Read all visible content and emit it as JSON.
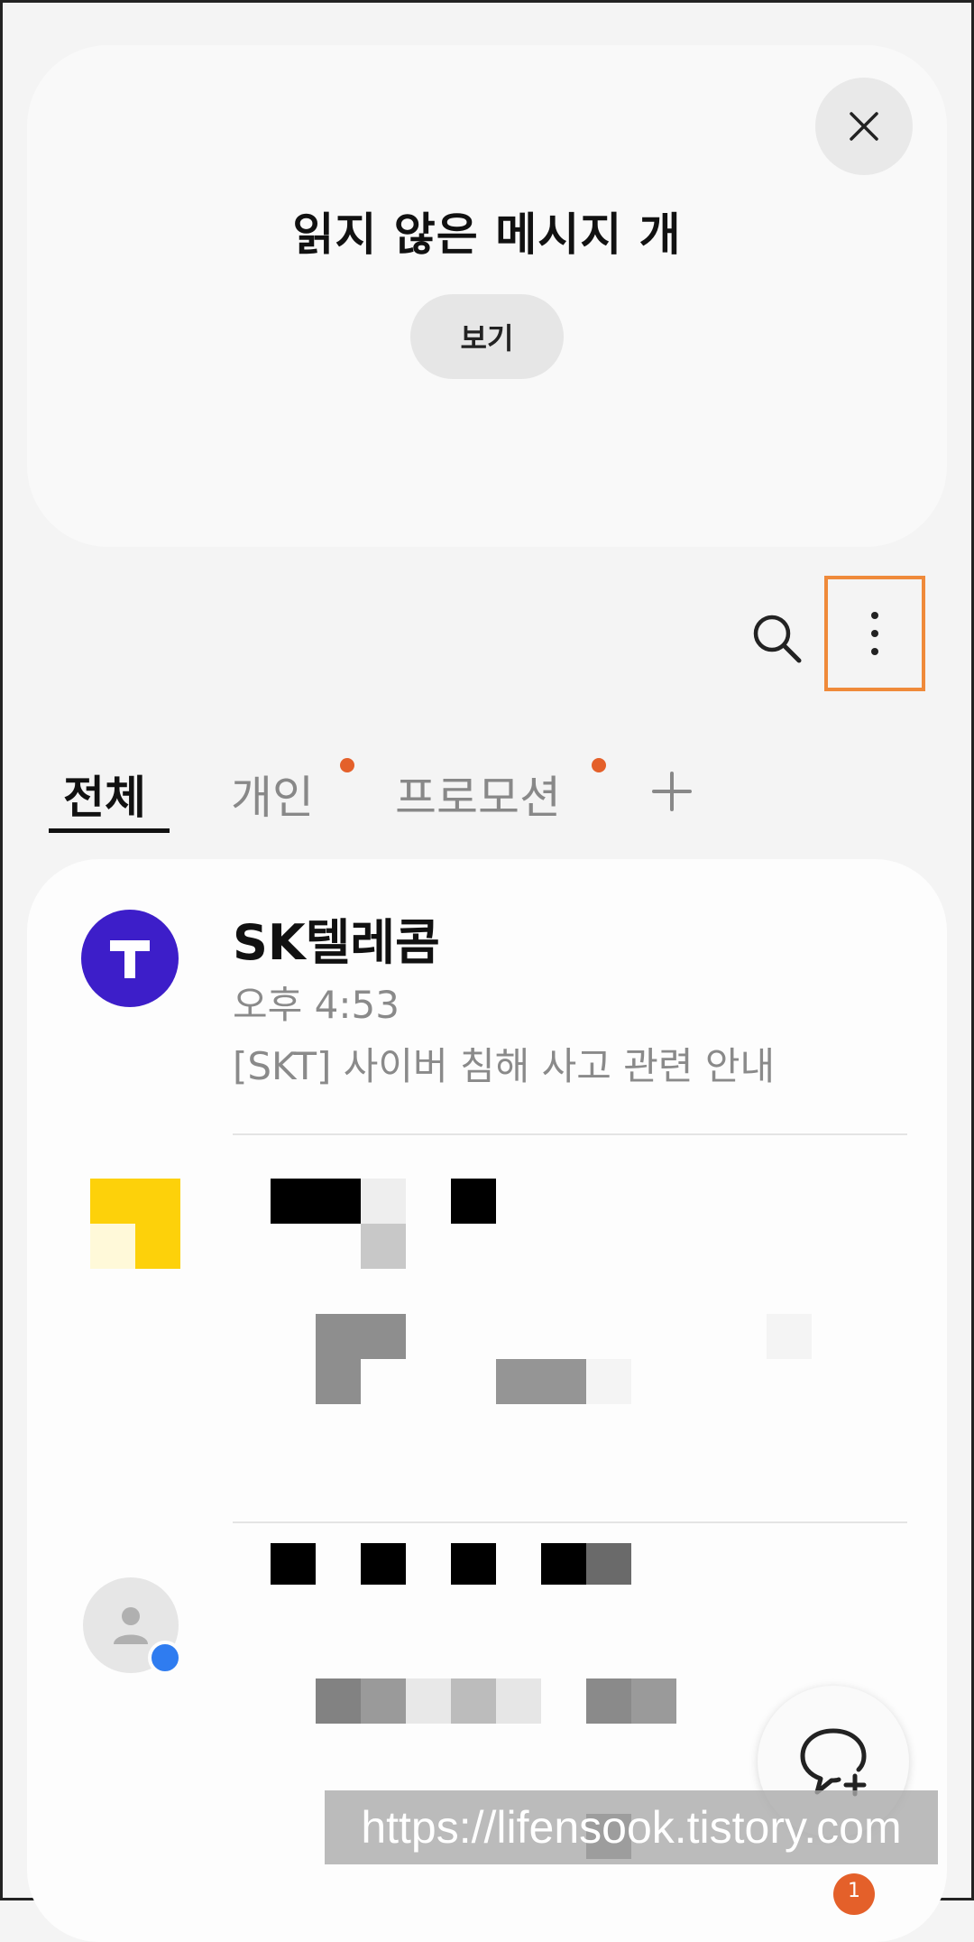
{
  "banner": {
    "title": "읽지 않은 메시지  개",
    "view_label": "보기"
  },
  "tabs": [
    {
      "label": "전체",
      "active": true,
      "has_dot": false
    },
    {
      "label": "개인",
      "active": false,
      "has_dot": true
    },
    {
      "label": "프로모션",
      "active": false,
      "has_dot": true
    }
  ],
  "conversations": [
    {
      "sender": "SK텔레콤",
      "time": "오후 4:53",
      "preview": "[SKT] 사이버 침해 사고 관련 안내"
    }
  ],
  "watermark": "https://lifensook.tistory.com",
  "notification_count": "1",
  "colors": {
    "accent": "#e4602a",
    "highlight": "#ef8a3a",
    "skt_brand": "#3d1ec9",
    "chat_badge": "#2f7cf0"
  },
  "icons": [
    "close-icon",
    "search-icon",
    "more-vert-icon",
    "plus-icon",
    "person-icon",
    "new-chat-icon"
  ]
}
